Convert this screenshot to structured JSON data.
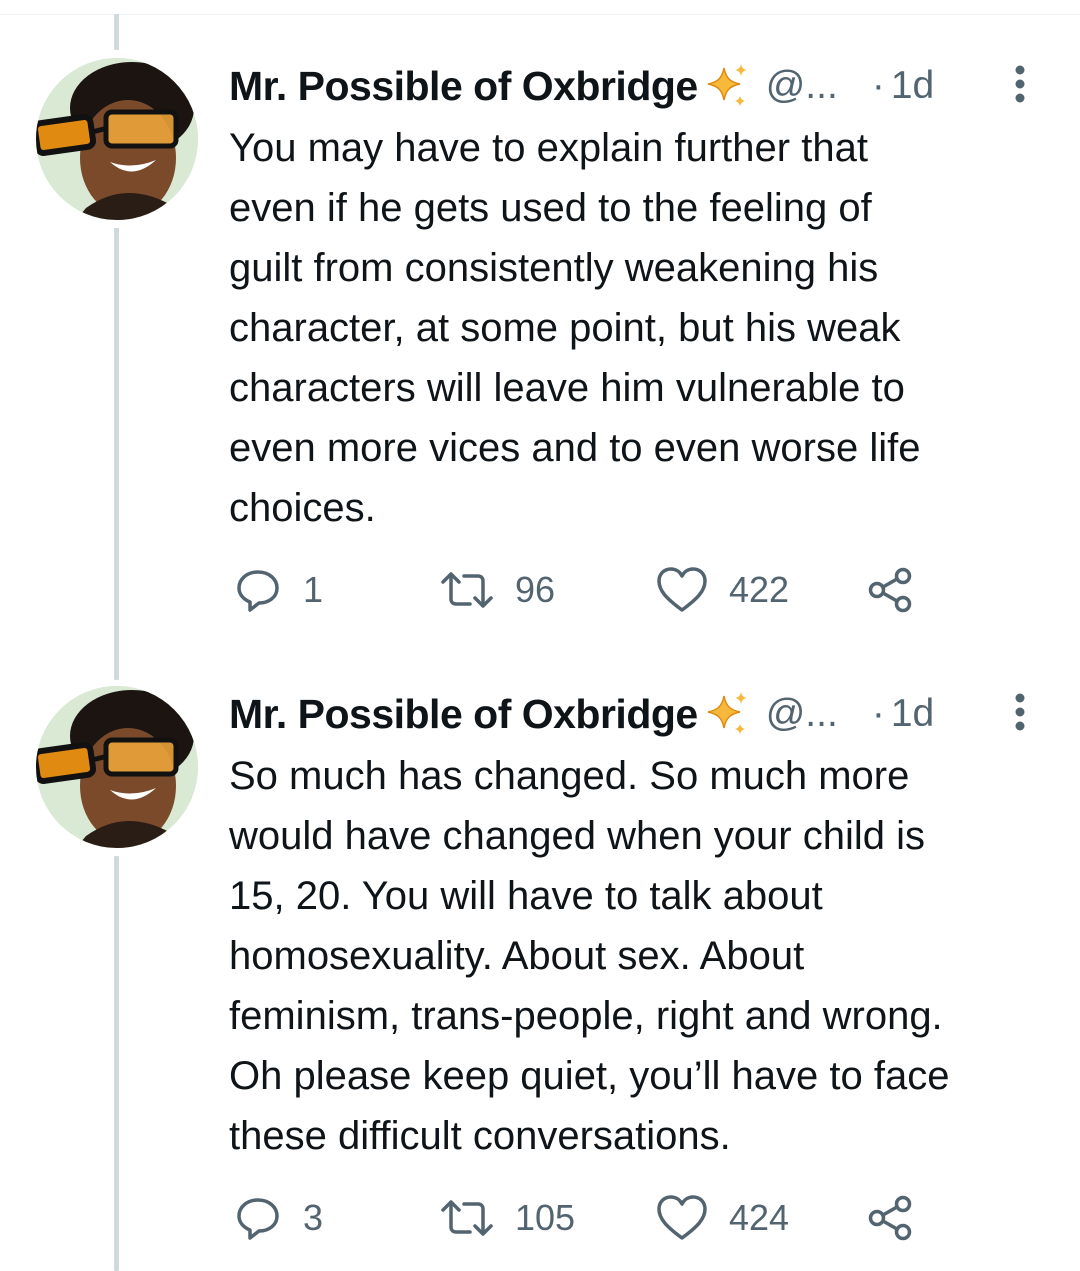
{
  "tweets": [
    {
      "display_name": "Mr. Possible of Oxbridge",
      "handle": "@...",
      "dot": "·",
      "time": "1d",
      "text": "You may have to explain further that\neven if he gets used to the feeling of\nguilt from consistently weakening his\ncharacter, at some point, but his weak\ncharacters will leave him vulnerable to\neven more vices and to even worse life\nchoices.",
      "replies": "1",
      "retweets": "96",
      "likes": "422"
    },
    {
      "display_name": "Mr. Possible of Oxbridge",
      "handle": "@...",
      "dot": "·",
      "time": "1d",
      "text": "So much has changed. So much more\nwould have changed when your child is\n15, 20. You will have to talk about\nhomosexuality. About sex. About\nfeminism, trans-people, right and wrong.\nOh please keep quiet, you’ll have to face\nthese difficult conversations.",
      "replies": "3",
      "retweets": "105",
      "likes": "424"
    }
  ],
  "icons": {
    "name_emoji": "sparkles-icon",
    "more": "more-options-icon",
    "reply": "reply-icon",
    "retweet": "retweet-icon",
    "like": "like-icon",
    "share": "share-icon"
  },
  "colors": {
    "text": "#0f1419",
    "secondary": "#536471",
    "thread_line": "#cfd9de",
    "sparkle": "#f4b400"
  }
}
